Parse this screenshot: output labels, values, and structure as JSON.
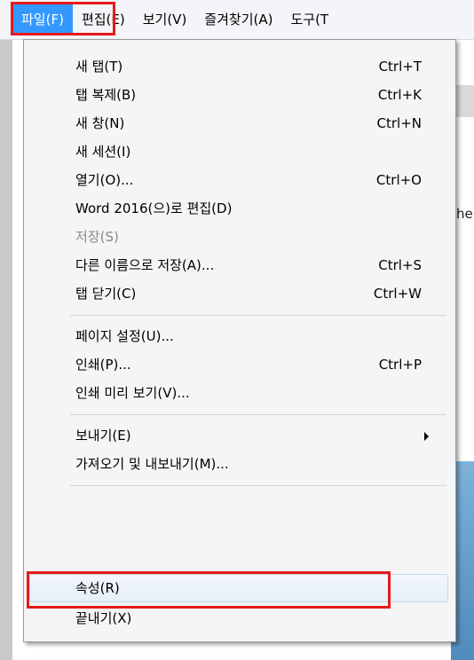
{
  "menubar": {
    "items": [
      {
        "label": "파일(F)"
      },
      {
        "label": "편집(E)"
      },
      {
        "label": "보기(V)"
      },
      {
        "label": "즐겨찾기(A)"
      },
      {
        "label": "도구(T"
      }
    ]
  },
  "background": {
    "snippet": "he"
  },
  "file_menu": {
    "items": [
      {
        "label": "새 탭(T)",
        "shortcut": "Ctrl+T"
      },
      {
        "label": "탭 복제(B)",
        "shortcut": "Ctrl+K"
      },
      {
        "label": "새 창(N)",
        "shortcut": "Ctrl+N"
      },
      {
        "label": "새 세션(I)",
        "shortcut": ""
      },
      {
        "label": "열기(O)...",
        "shortcut": "Ctrl+O"
      },
      {
        "label": "Word 2016(으)로 편집(D)",
        "shortcut": ""
      },
      {
        "label": "저장(S)",
        "shortcut": ""
      },
      {
        "label": "다른 이름으로 저장(A)...",
        "shortcut": "Ctrl+S"
      },
      {
        "label": "탭 닫기(C)",
        "shortcut": "Ctrl+W"
      },
      {
        "label": "페이지 설정(U)...",
        "shortcut": ""
      },
      {
        "label": "인쇄(P)...",
        "shortcut": "Ctrl+P"
      },
      {
        "label": "인쇄 미리 보기(V)...",
        "shortcut": ""
      },
      {
        "label": "보내기(E)",
        "shortcut": ""
      },
      {
        "label": "가져오기 및 내보내기(M)...",
        "shortcut": ""
      },
      {
        "label": "속성(R)",
        "shortcut": ""
      },
      {
        "label": "끝내기(X)",
        "shortcut": ""
      }
    ]
  },
  "colors": {
    "highlight": "#e41b1b",
    "menubar_active": "#3399ff"
  }
}
